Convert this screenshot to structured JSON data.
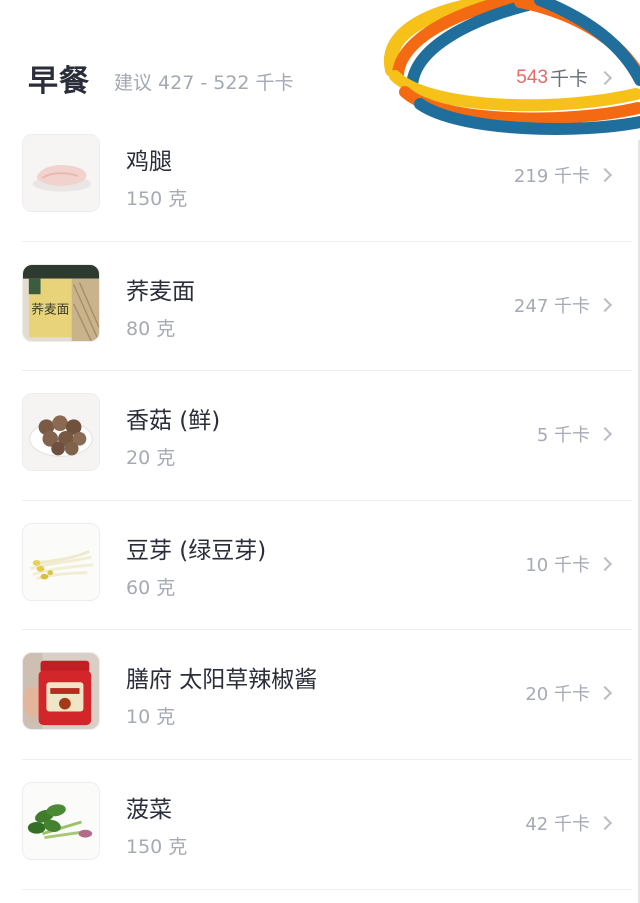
{
  "meal": {
    "title": "早餐",
    "suggestion": "建议 427 - 522 千卡",
    "total_value": "543",
    "total_unit": "千卡"
  },
  "foods": [
    {
      "name": "鸡腿",
      "amount": "150 克",
      "kcal": "219 千卡",
      "icon": "chicken-leg-icon"
    },
    {
      "name": "荞麦面",
      "amount": "80 克",
      "kcal": "247 千卡",
      "icon": "buckwheat-noodles-icon"
    },
    {
      "name": "香菇 (鲜)",
      "amount": "20 克",
      "kcal": "5 千卡",
      "icon": "shiitake-mushroom-icon"
    },
    {
      "name": "豆芽 (绿豆芽)",
      "amount": "60 克",
      "kcal": "10 千卡",
      "icon": "bean-sprouts-icon"
    },
    {
      "name": "膳府 太阳草辣椒酱",
      "amount": "10 克",
      "kcal": "20 千卡",
      "icon": "chili-sauce-jar-icon"
    },
    {
      "name": "菠菜",
      "amount": "150 克",
      "kcal": "42 千卡",
      "icon": "spinach-icon"
    }
  ],
  "colors": {
    "title": "#2a2d3a",
    "muted": "#a3a8b3",
    "total_accent": "#e46a6a",
    "scribble_yellow": "#f6c21a",
    "scribble_orange": "#f36a12",
    "scribble_blue": "#1f6e9c"
  }
}
